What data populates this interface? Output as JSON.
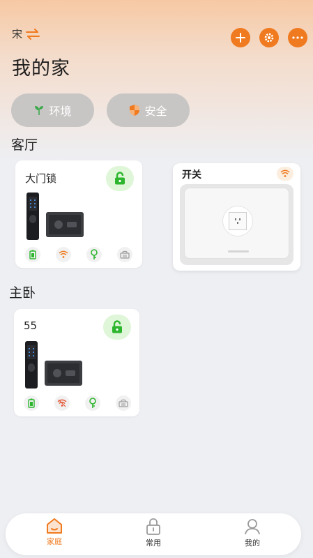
{
  "header": {
    "user_name": "宋",
    "home_title": "我的家",
    "actions": [
      "add-icon",
      "gear-icon",
      "more-icon"
    ]
  },
  "chips": [
    {
      "label": "环境",
      "icon": "sprout-icon"
    },
    {
      "label": "安全",
      "icon": "shield-icon"
    }
  ],
  "rooms": [
    {
      "name": "客厅",
      "devices": [
        {
          "name": "大门锁",
          "type": "lock",
          "status_icons": [
            "battery-icon",
            "wifi-icon",
            "key-icon",
            "fingerprint-lock-icon"
          ]
        },
        {
          "name": "开关",
          "type": "switch",
          "status_icons": [
            "wifi-icon"
          ]
        }
      ]
    },
    {
      "name": "主卧",
      "devices": [
        {
          "name": "55",
          "type": "lock",
          "status_icons": [
            "battery-icon",
            "wifi-off-icon",
            "key-icon",
            "fingerprint-lock-icon"
          ]
        }
      ]
    }
  ],
  "tabbar": [
    {
      "label": "家庭",
      "icon": "home-icon",
      "active": true
    },
    {
      "label": "常用",
      "icon": "lock-icon",
      "active": false
    },
    {
      "label": "我的",
      "icon": "user-icon",
      "active": false
    }
  ],
  "colors": {
    "accent": "#f07a1f",
    "lock_green": "#2db52d",
    "chip_bg": "#c8c6c5"
  }
}
